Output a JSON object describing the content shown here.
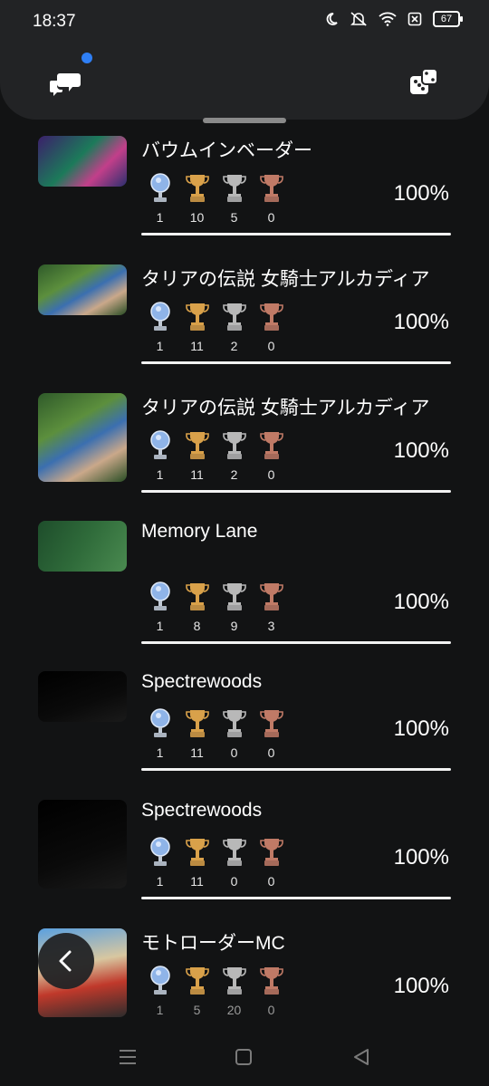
{
  "status": {
    "time": "18:37",
    "battery": "67"
  },
  "games": [
    {
      "title": "バウムインベーダー",
      "platinum": "1",
      "gold": "10",
      "silver": "5",
      "bronze": "0",
      "percent": "100%",
      "progress": 1.0,
      "thumb": "purple"
    },
    {
      "title": "タリアの伝説 女騎士アルカディア",
      "platinum": "1",
      "gold": "11",
      "silver": "2",
      "bronze": "0",
      "percent": "100%",
      "progress": 1.0,
      "thumb": "forest"
    },
    {
      "title": "タリアの伝説 女騎士アルカディア",
      "platinum": "1",
      "gold": "11",
      "silver": "2",
      "bronze": "0",
      "percent": "100%",
      "progress": 1.0,
      "thumb": "forest"
    },
    {
      "title": "Memory Lane",
      "platinum": "1",
      "gold": "8",
      "silver": "9",
      "bronze": "3",
      "percent": "100%",
      "progress": 1.0,
      "thumb": "green"
    },
    {
      "title": "Spectrewoods",
      "platinum": "1",
      "gold": "11",
      "silver": "0",
      "bronze": "0",
      "percent": "100%",
      "progress": 1.0,
      "thumb": "dark"
    },
    {
      "title": "Spectrewoods",
      "platinum": "1",
      "gold": "11",
      "silver": "0",
      "bronze": "0",
      "percent": "100%",
      "progress": 1.0,
      "thumb": "dark"
    },
    {
      "title": "モトローダーMC",
      "platinum": "1",
      "gold": "5",
      "silver": "20",
      "bronze": "0",
      "percent": "100%",
      "progress": 1.0,
      "thumb": "race"
    }
  ],
  "colors": {
    "platinum": "#8fb4e8",
    "gold": "#d9a14a",
    "silver": "#b8b8b8",
    "bronze": "#c07a66",
    "notification": "#2f7ff5"
  },
  "icons": {
    "chat": "chat-bubbles-icon",
    "dice": "dice-icon",
    "back": "chevron-left-icon"
  }
}
